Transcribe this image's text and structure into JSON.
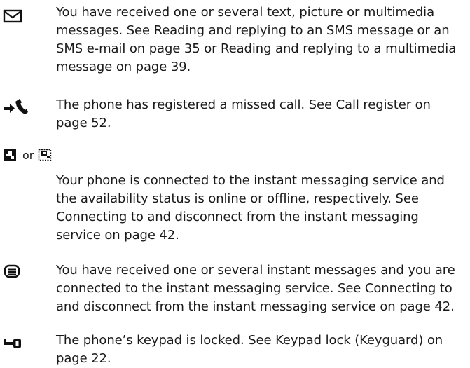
{
  "entries": {
    "messages": {
      "icon": "envelope-icon",
      "text": "You have received one or several text, picture or multimedia messages. See Reading and replying to an SMS message or an SMS e-mail on page 35 or Reading and replying to a multimedia message on page 39."
    },
    "missed_call": {
      "icon": "missed-call-icon",
      "text": "The phone has registered a missed call. See Call register on page 52."
    },
    "im_status": {
      "icons": [
        "im-online-icon",
        "im-offline-icon"
      ],
      "or_label": "or",
      "text": "Your phone is connected to the instant messaging service and the availability status is online or offline, respectively. See Connecting to and disconnect from the instant messaging service on page 42."
    },
    "instant_messages": {
      "icon": "instant-message-icon",
      "text": "You have received one or several instant messages and you are connected to the instant messaging service. See Connecting to and disconnect from the instant messaging service on page 42."
    },
    "keypad_lock": {
      "icon": "keypad-lock-icon",
      "text": "The phone’s keypad is locked. See Keypad lock (Keyguard) on page 22."
    }
  }
}
